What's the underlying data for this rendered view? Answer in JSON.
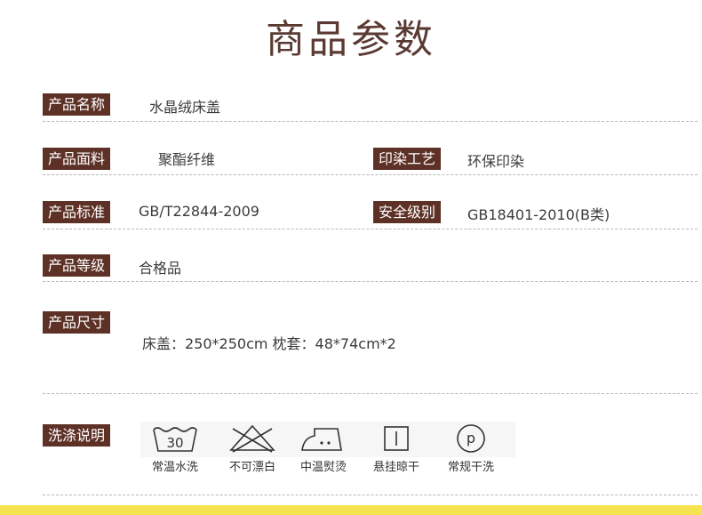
{
  "title": "商品参数",
  "params": {
    "name_label": "产品名称",
    "name_value": "水晶绒床盖",
    "fabric_label": "产品面料",
    "fabric_value": "聚酯纤维",
    "dye_label": "印染工艺",
    "dye_value": "环保印染",
    "standard_label": "产品标准",
    "standard_value": "GB/T22844-2009",
    "safety_label": "安全级别",
    "safety_value": "GB18401-2010(B类)",
    "grade_label": "产品等级",
    "grade_value": "合格品",
    "size_label": "产品尺寸",
    "size_value": "床盖：250*250cm 枕套：48*74cm*2"
  },
  "care": {
    "label": "洗涤说明",
    "items": [
      {
        "icon": "wash-tub-icon",
        "icon_text": "30",
        "text": "常温水洗"
      },
      {
        "icon": "no-bleach-icon",
        "text": "不可漂白"
      },
      {
        "icon": "iron-icon",
        "text": "中温熨烫"
      },
      {
        "icon": "hang-dry-icon",
        "text": "悬挂晾干"
      },
      {
        "icon": "dry-clean-icon",
        "icon_text": "p",
        "text": "常规干洗"
      }
    ]
  },
  "colors": {
    "label_bg": "#5e3126",
    "accent_bar": "#f5e44f"
  }
}
